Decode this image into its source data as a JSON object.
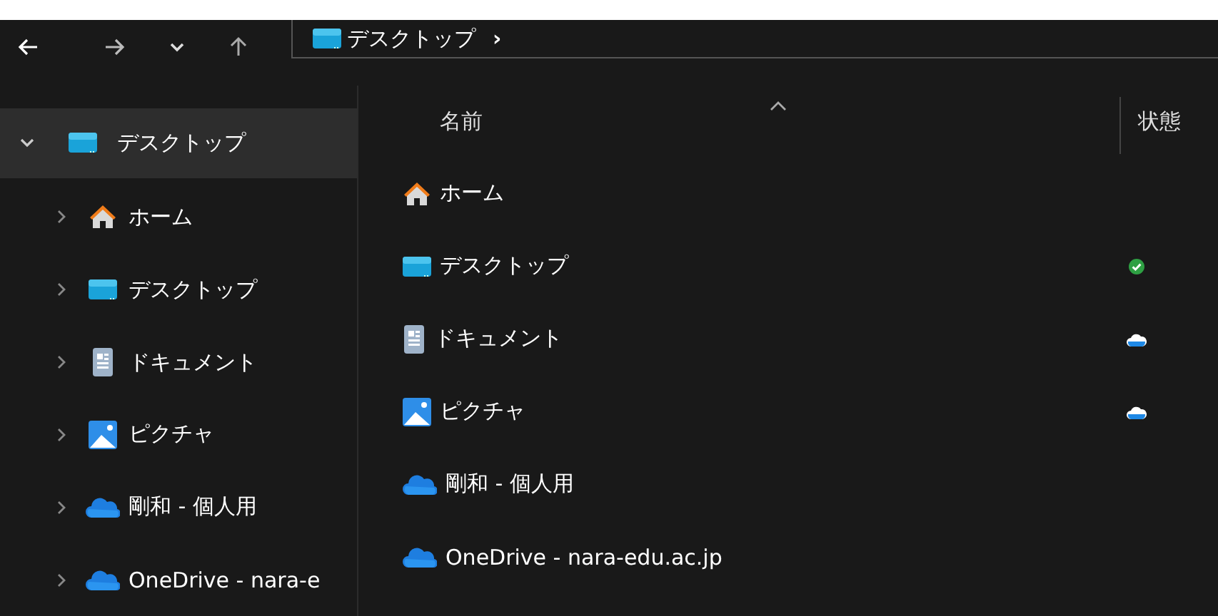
{
  "address_bar": {
    "crumbs": [
      "デスクトップ"
    ],
    "separator": "›"
  },
  "sidebar": {
    "items": [
      {
        "label": "デスクトップ",
        "kind": "desktop",
        "expanded": true,
        "selected": true
      },
      {
        "label": "ホーム",
        "kind": "home",
        "expanded": false,
        "selected": false
      },
      {
        "label": "デスクトップ",
        "kind": "desktop",
        "expanded": false,
        "selected": false
      },
      {
        "label": "ドキュメント",
        "kind": "document",
        "expanded": false,
        "selected": false
      },
      {
        "label": "ピクチャ",
        "kind": "pictures",
        "expanded": false,
        "selected": false
      },
      {
        "label": "剛和 - 個人用",
        "kind": "cloud",
        "expanded": false,
        "selected": false
      },
      {
        "label": "OneDrive - nara-e",
        "kind": "cloud",
        "expanded": false,
        "selected": false
      }
    ]
  },
  "list": {
    "columns": [
      "名前",
      "状態"
    ],
    "rows": [
      {
        "name": "ホーム",
        "kind": "home"
      },
      {
        "name": "デスクトップ",
        "kind": "desktop",
        "status": {
          "kind": "synced"
        }
      },
      {
        "name": "ドキュメント",
        "kind": "document",
        "status": {
          "kind": "cloud"
        }
      },
      {
        "name": "ピクチャ",
        "kind": "pictures",
        "status": {
          "kind": "cloud"
        }
      },
      {
        "name": "剛和 - 個人用",
        "kind": "cloud"
      },
      {
        "name": "OneDrive - nara-edu.ac.jp",
        "kind": "cloud"
      }
    ]
  }
}
